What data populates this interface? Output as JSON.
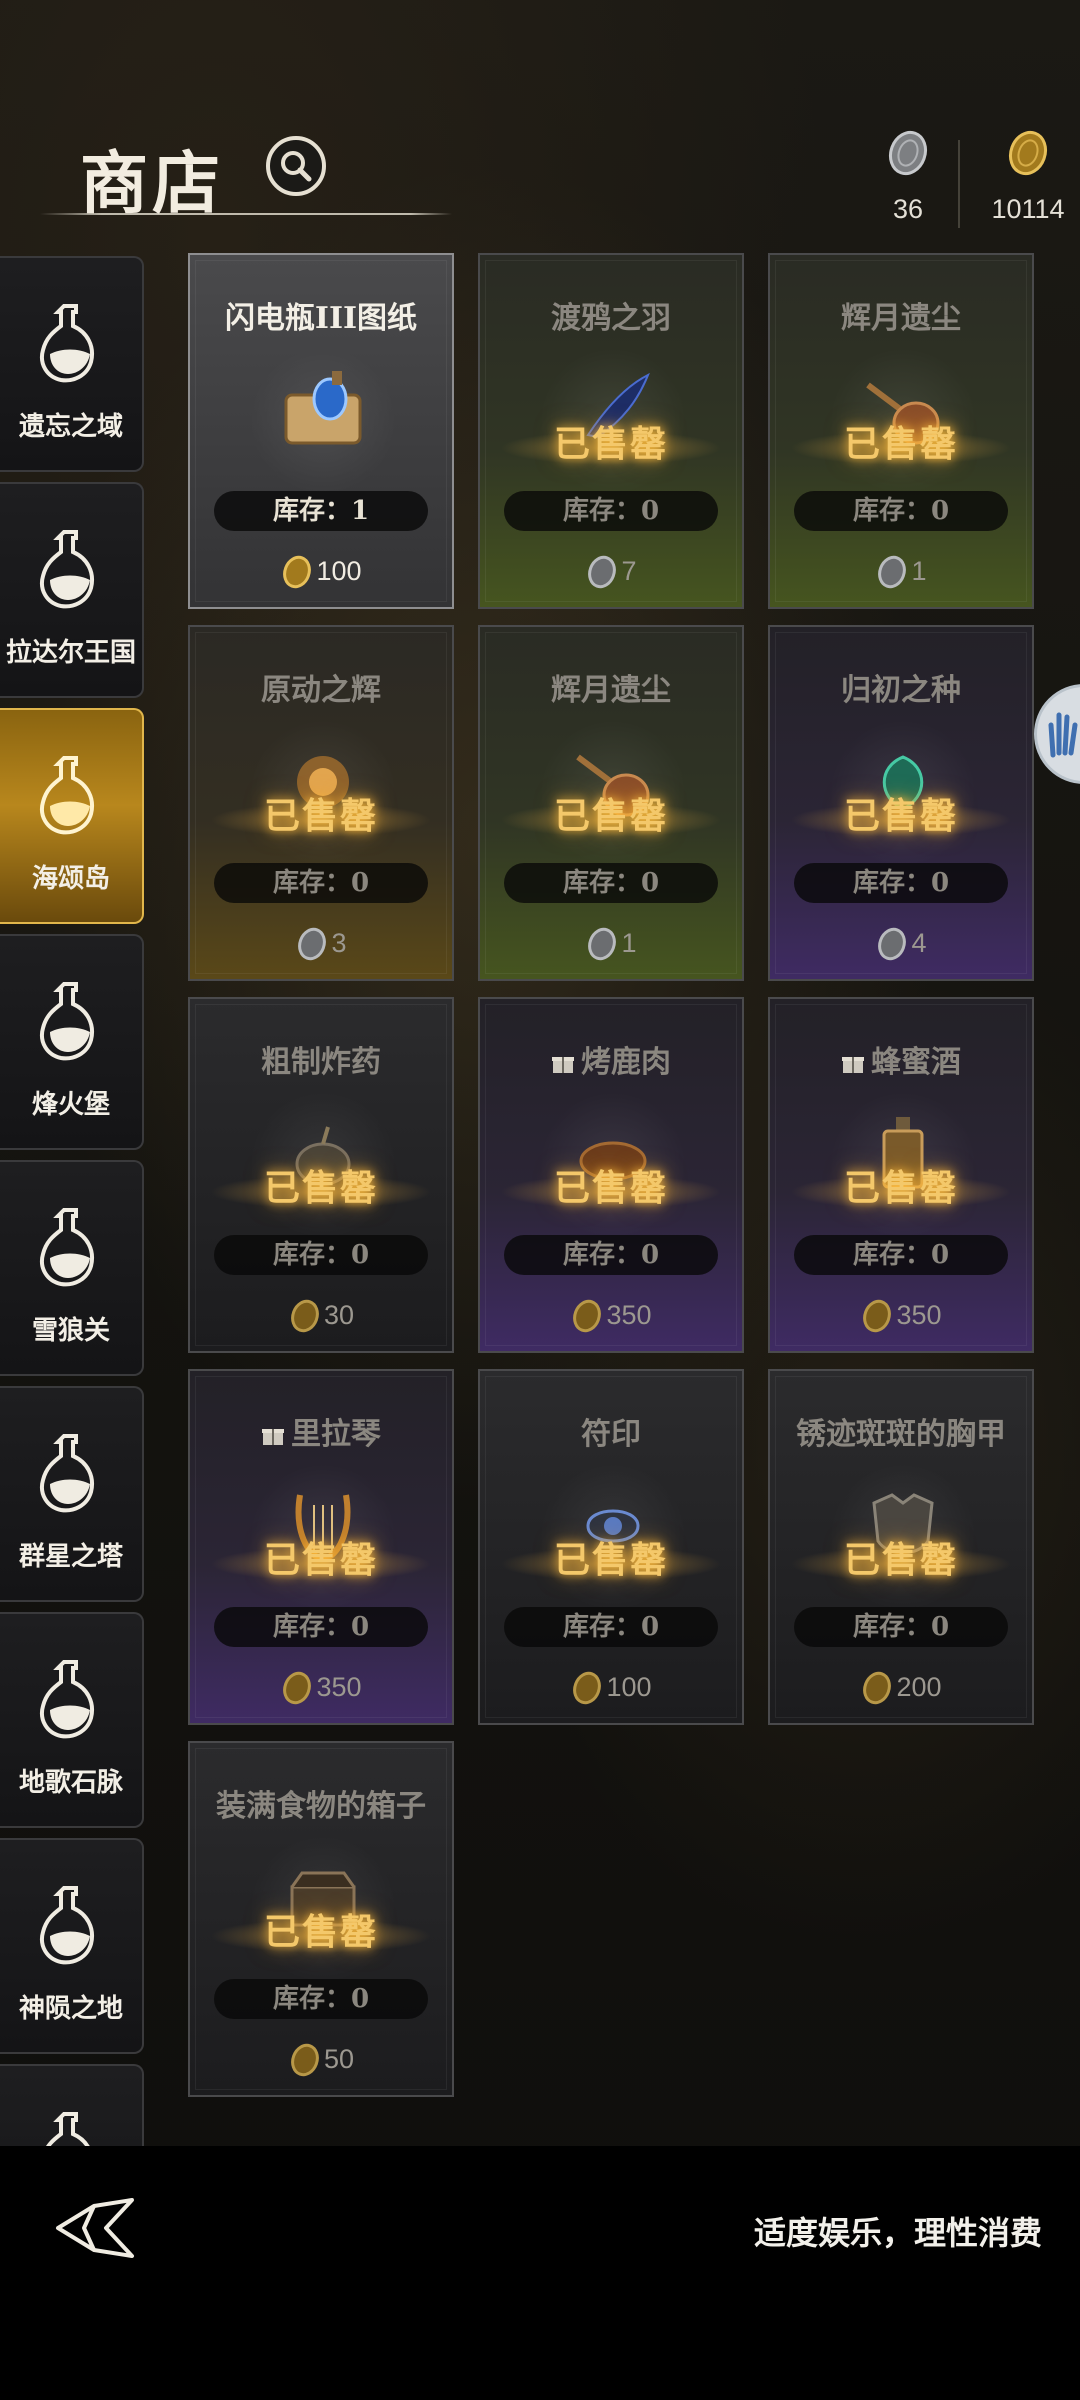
{
  "header": {
    "title": "商店",
    "search_icon": "search-icon"
  },
  "currency": {
    "silver": {
      "icon": "silver-coin-icon",
      "amount": "36"
    },
    "gold": {
      "icon": "gold-coin-icon",
      "amount": "10114"
    }
  },
  "sidebar": {
    "items": [
      {
        "label": "遗忘之域",
        "icon": "flask-icon",
        "active": false
      },
      {
        "label": "拉达尔王国",
        "icon": "flask-icon",
        "active": false
      },
      {
        "label": "海颂岛",
        "icon": "flask-icon",
        "active": true
      },
      {
        "label": "烽火堡",
        "icon": "flask-icon",
        "active": false
      },
      {
        "label": "雪狼关",
        "icon": "flask-icon",
        "active": false
      },
      {
        "label": "群星之塔",
        "icon": "flask-icon",
        "active": false
      },
      {
        "label": "地歌石脉",
        "icon": "flask-icon",
        "active": false
      },
      {
        "label": "神陨之地",
        "icon": "flask-icon",
        "active": false
      },
      {
        "label": "",
        "icon": "flask-icon",
        "active": false
      }
    ]
  },
  "shop": {
    "sold_label": "已售罄",
    "items": [
      {
        "name": "闪电瓶III图纸",
        "stock": "库存：1",
        "price": "100",
        "currency": "gold",
        "sold": false,
        "gift": false,
        "rarity": "grey",
        "selected": true
      },
      {
        "name": "渡鸦之羽",
        "stock": "库存：0",
        "price": "7",
        "currency": "silver",
        "sold": true,
        "gift": false,
        "rarity": "green"
      },
      {
        "name": "辉月遗尘",
        "stock": "库存：0",
        "price": "1",
        "currency": "silver",
        "sold": true,
        "gift": false,
        "rarity": "green"
      },
      {
        "name": "原动之辉",
        "stock": "库存：0",
        "price": "3",
        "currency": "silver",
        "sold": true,
        "gift": false,
        "rarity": "yellow"
      },
      {
        "name": "辉月遗尘",
        "stock": "库存：0",
        "price": "1",
        "currency": "silver",
        "sold": true,
        "gift": false,
        "rarity": "green"
      },
      {
        "name": "归初之种",
        "stock": "库存：0",
        "price": "4",
        "currency": "silver",
        "sold": true,
        "gift": false,
        "rarity": "purple"
      },
      {
        "name": "粗制炸药",
        "stock": "库存：0",
        "price": "30",
        "currency": "gold",
        "sold": true,
        "gift": false,
        "rarity": "grey"
      },
      {
        "name": "烤鹿肉",
        "stock": "库存：0",
        "price": "350",
        "currency": "gold",
        "sold": true,
        "gift": true,
        "rarity": "purple"
      },
      {
        "name": "蜂蜜酒",
        "stock": "库存：0",
        "price": "350",
        "currency": "gold",
        "sold": true,
        "gift": true,
        "rarity": "purple"
      },
      {
        "name": "里拉琴",
        "stock": "库存：0",
        "price": "350",
        "currency": "gold",
        "sold": true,
        "gift": true,
        "rarity": "purple"
      },
      {
        "name": "符印",
        "stock": "库存：0",
        "price": "100",
        "currency": "gold",
        "sold": true,
        "gift": false,
        "rarity": "grey"
      },
      {
        "name": "锈迹斑斑的胸甲",
        "stock": "库存：0",
        "price": "200",
        "currency": "gold",
        "sold": true,
        "gift": false,
        "rarity": "grey"
      },
      {
        "name": "装满食物的箱子",
        "stock": "库存：0",
        "price": "50",
        "currency": "gold",
        "sold": true,
        "gift": false,
        "rarity": "grey"
      }
    ]
  },
  "footer": {
    "slogan": "适度娱乐，理性消费",
    "logo": "game-logo-icon"
  },
  "colors": {
    "accent_gold": "#e1b64b",
    "sold_text": "#f4c86a",
    "background": "#131210"
  }
}
